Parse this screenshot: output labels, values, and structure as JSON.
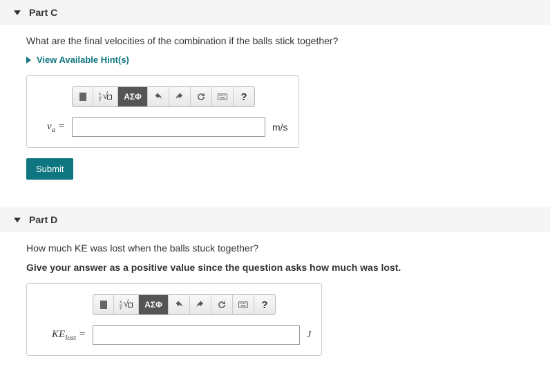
{
  "partC": {
    "title": "Part C",
    "question": "What are the final velocities of the combination if the balls stick together?",
    "hintsLabel": "View Available Hint(s)",
    "varLabelHtml": "v<span class='sub'>a</span> =",
    "unit": "m/s",
    "answerValue": ""
  },
  "partD": {
    "title": "Part D",
    "question": "How much KE was lost when the balls stuck together?",
    "instruction": "Give your answer as a positive value since the question asks how much was lost.",
    "varLabelHtml": "KE<span class='sub'>lost</span> =",
    "unit": "J",
    "answerValue": ""
  },
  "toolbar": {
    "greek": "ΑΣΦ",
    "help": "?"
  },
  "submitLabel": "Submit"
}
